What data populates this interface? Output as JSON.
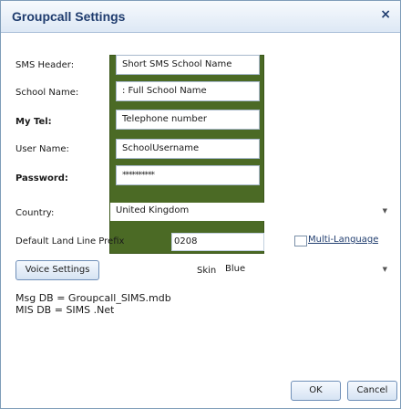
{
  "window": {
    "title": "Groupcall Settings",
    "close": "×"
  },
  "labels": {
    "sms_header": "SMS Header:",
    "school_name": "School Name:",
    "my_tel": "My Tel:",
    "user_name": "User Name:",
    "password": "Password:",
    "country": "Country:",
    "default_prefix": "Default Land Line Prefix",
    "skin": "Skin",
    "msg_db": "Msg DB = Groupcall_SIMS.mdb",
    "mis_db": "MIS DB = SIMS .Net"
  },
  "fields": {
    "sms_header": "Short SMS School Name",
    "school_name": ": Full School Name",
    "my_tel": "Telephone number",
    "user_name": "SchoolUsername",
    "password": "**********",
    "prefix": "0208"
  },
  "combos": {
    "country": "United Kingdom",
    "skin": "Blue"
  },
  "checkbox": {
    "label": "Multi-Language",
    "checked": false
  },
  "buttons": {
    "voice": "Voice Settings",
    "ok": "OK",
    "cancel": "Cancel"
  },
  "colors": {
    "accent": "#4b6a25",
    "title": "#1f3c6e",
    "border": "#7f9db9"
  },
  "icons": {
    "close": "close-icon",
    "dropdown": "chevron-down-icon"
  }
}
